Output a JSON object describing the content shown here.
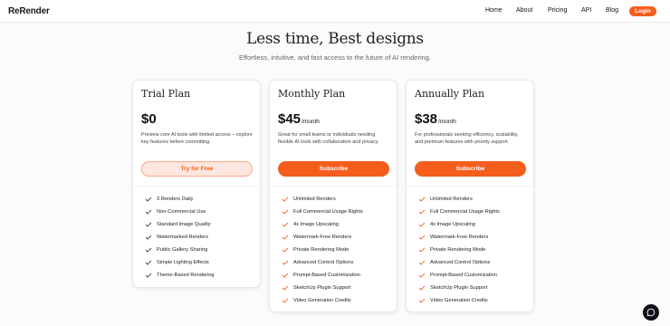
{
  "nav": {
    "logo": "ReRender",
    "links": [
      "Home",
      "About",
      "Pricing",
      "API",
      "Blog"
    ],
    "login": "Login"
  },
  "hero": {
    "title": "Less time, Best designs",
    "subtitle": "Effortless, intuitive, and fast access to the future of AI rendering."
  },
  "colors": {
    "accent": "#f45d1c",
    "accent_soft": "#fde6dd",
    "check_dark": "#333333"
  },
  "plans": [
    {
      "name": "Trial Plan",
      "price": "$0",
      "period": "",
      "description": "Preview core AI tools with limited access – explore key features before committing.",
      "cta": "Try for Free",
      "features": [
        "3 Renders Daily",
        "Non-Commercial Use",
        "Standard Image Quality",
        "Watermarked Renders",
        "Public Gallery Sharing",
        "Simple Lighting Effects",
        "Theme-Based Rendering"
      ]
    },
    {
      "name": "Monthly Plan",
      "price": "$45",
      "period": "/month",
      "description": "Great for small teams or individuals needing flexible AI tools with collaboration and privacy.",
      "cta": "Subscribe",
      "features": [
        "Unlimited Renders",
        "Full Commercial Usage Rights",
        "4x Image Upscaling",
        "Watermark-Free Renders",
        "Private Rendering Mode",
        "Advanced Control Options",
        "Prompt-Based Customization",
        "SketchUp Plugin Support",
        "Video Generation Credits"
      ]
    },
    {
      "name": "Annually Plan",
      "price": "$38",
      "period": "/month",
      "description": "For professionals seeking efficiency, scalability, and premium features with priority support.",
      "cta": "Subscribe",
      "features": [
        "Unlimited Renders",
        "Full Commercial Usage Rights",
        "4x Image Upscaling",
        "Watermark-Free Renders",
        "Private Rendering Mode",
        "Advanced Control Options",
        "Prompt-Based Customization",
        "SketchUp Plugin Support",
        "Video Generation Credits"
      ]
    }
  ],
  "icons": {
    "feature": "check-icon",
    "chat": "chat-bubble-icon"
  }
}
